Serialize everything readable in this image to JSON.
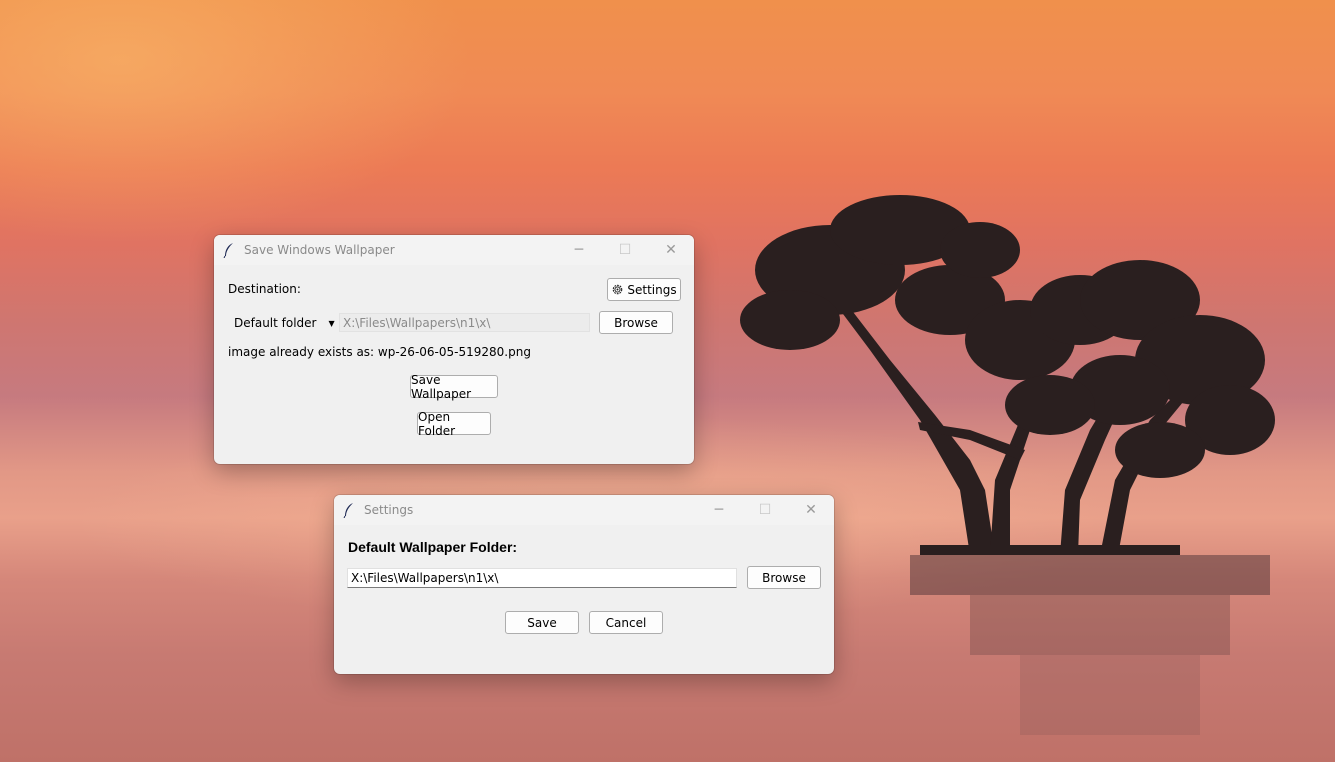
{
  "main_window": {
    "title": "Save Windows Wallpaper",
    "destination_label": "Destination:",
    "settings_button": "Settings",
    "folder_select_value": "Default folder",
    "path_field_value": "X:\\Files\\Wallpapers\\n1\\x\\",
    "browse_button": "Browse",
    "status_text": "image already exists as: wp-26-06-05-519280.png",
    "save_button": "Save Wallpaper",
    "open_folder_button": "Open Folder"
  },
  "settings_window": {
    "title": "Settings",
    "heading": "Default Wallpaper Folder:",
    "path_input_value": "X:\\Files\\Wallpapers\\n1\\x\\",
    "browse_button": "Browse",
    "save_button": "Save",
    "cancel_button": "Cancel"
  },
  "titlebar_glyphs": {
    "minimize": "─",
    "maximize": "☐",
    "close": "✕"
  },
  "icons": {
    "app": "feather-icon",
    "settings": "gear-icon",
    "dropdown": "caret-down-icon"
  }
}
